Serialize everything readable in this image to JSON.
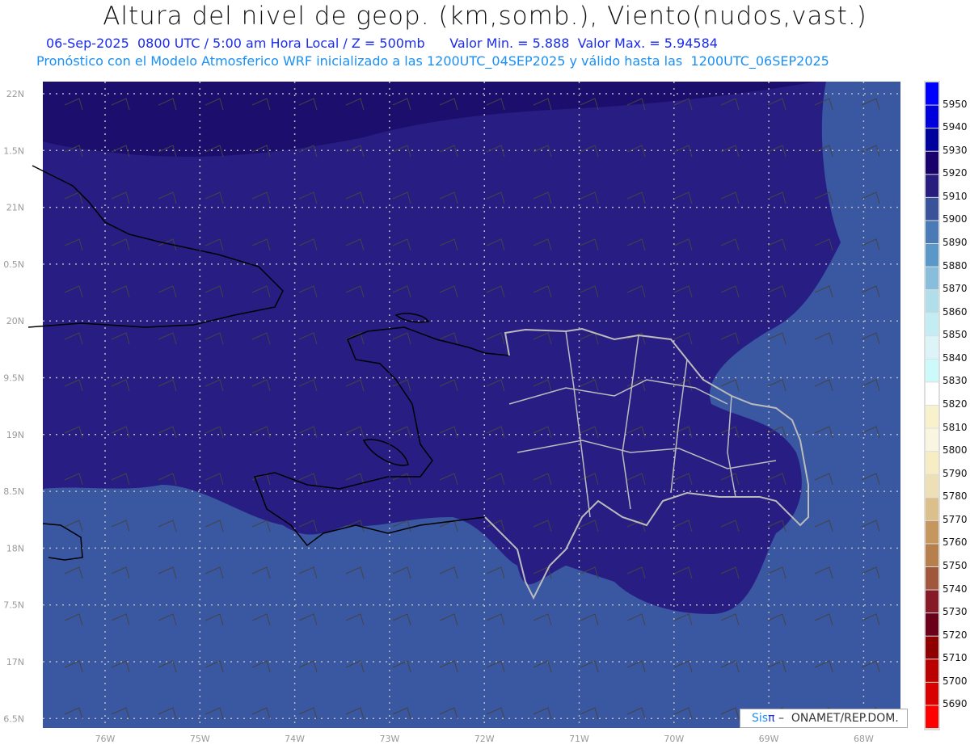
{
  "title": "Altura del nivel de geop. (km,somb.), Viento(nudos,vast.)",
  "subtitle_date": "06-Sep-2025  0800 UTC / 5:00 am Hora Local / Z = 500mb",
  "subtitle_minmax": "Valor Min. = 5.888  Valor Max. = 5.94584",
  "subtitle_model": "Pronóstico con el Modelo Atmosferico WRF inicializado a las 1200UTC_04SEP2025 y válido hasta las  1200UTC_06SEP2025",
  "map": {
    "lon_labels": [
      "76W",
      "75W",
      "74W",
      "73W",
      "72W",
      "71W",
      "70W",
      "69W",
      "68W"
    ],
    "lat_labels": [
      "22N",
      "1.5N",
      "21N",
      "0.5N",
      "20N",
      "9.5N",
      "19N",
      "8.5N",
      "18N",
      "7.5N",
      "17N",
      "6.5N"
    ],
    "fill_colors": {
      "top": "#1c0e6c",
      "mid": "#281d83",
      "low": "#3a58a2"
    }
  },
  "colorbar": {
    "labels": [
      "5950",
      "5940",
      "5930",
      "5920",
      "5910",
      "5900",
      "5890",
      "5880",
      "5870",
      "5860",
      "5850",
      "5840",
      "5830",
      "5820",
      "5810",
      "5800",
      "5790",
      "5780",
      "5770",
      "5760",
      "5750",
      "5740",
      "5730",
      "5720",
      "5710",
      "5700",
      "5690"
    ],
    "colors": [
      "#0000ff",
      "#0000dd",
      "#00009c",
      "#1a006b",
      "#281d7e",
      "#3a5299",
      "#4a7bb7",
      "#5b98c8",
      "#88bedc",
      "#b0dfea",
      "#c3ecf3",
      "#dcf4f8",
      "#ccfafa",
      "#ffffff",
      "#f8f2cc",
      "#faf5e0",
      "#f6edc4",
      "#eee0b6",
      "#dcc08c",
      "#c6965f",
      "#b77f4c",
      "#a0573c",
      "#861a26",
      "#6a001a",
      "#8f0000",
      "#ba0000",
      "#d90000",
      "#ff0000"
    ]
  },
  "logo": {
    "sis": "Sis",
    "pi": "π",
    "text": "–  ONAMET/REP.DOM."
  }
}
